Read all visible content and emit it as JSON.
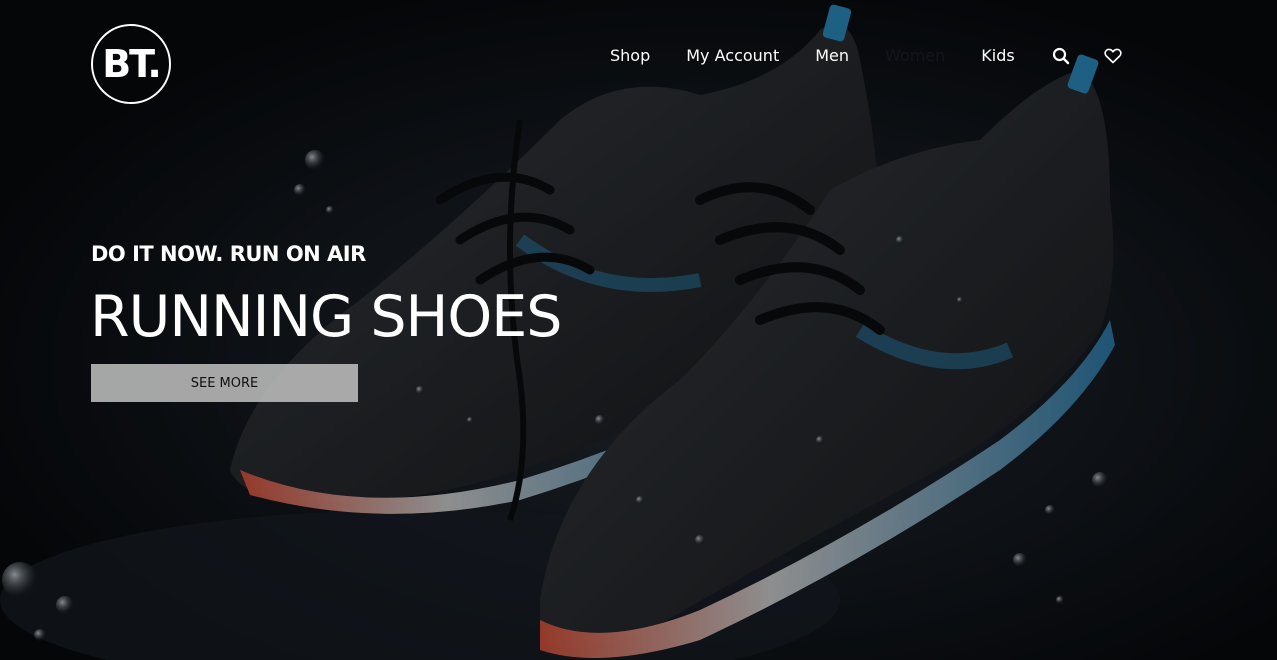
{
  "brand": {
    "logo_text": "BT."
  },
  "nav": {
    "items": [
      {
        "label": "Shop"
      },
      {
        "label": "My Account"
      },
      {
        "label": "Men"
      },
      {
        "label": "Women"
      },
      {
        "label": "Kids"
      }
    ],
    "icons": [
      "search-icon",
      "heart-icon"
    ]
  },
  "hero": {
    "tagline": "DO IT NOW. RUN ON AIR",
    "headline": "RUNNING SHOES",
    "cta_label": "SEE MORE",
    "image_subject": "wet black running shoes"
  },
  "colors": {
    "background": "#0d1116",
    "text": "#ffffff",
    "button_bg": "#c8c8c8",
    "button_text": "#111111",
    "accent_blue": "#2a86b8",
    "accent_red": "#d0503a"
  }
}
